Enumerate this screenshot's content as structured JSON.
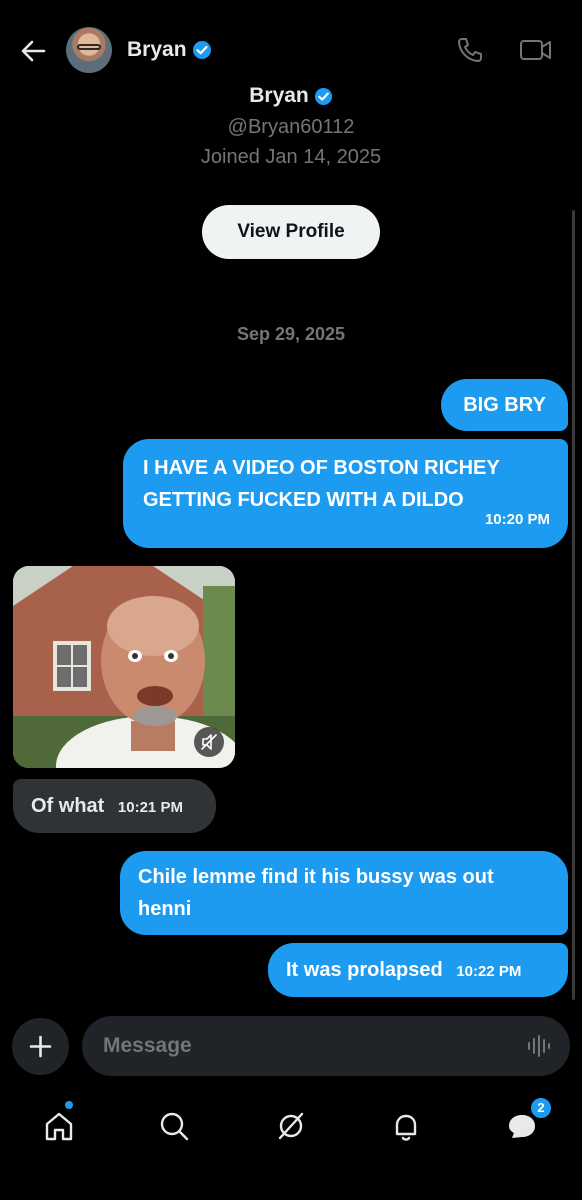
{
  "header": {
    "name": "Bryan",
    "verified": true
  },
  "profile": {
    "name": "Bryan",
    "handle": "@Bryan60112",
    "joined": "Joined Jan 14, 2025",
    "view_profile_label": "View Profile"
  },
  "conversation": {
    "date": "Sep 29, 2025",
    "messages": [
      {
        "direction": "out",
        "text": "BIG BRY"
      },
      {
        "direction": "out",
        "text": "I HAVE A VIDEO OF BOSTON RICHEY GETTING FUCKED WITH A DILDO",
        "time": "10:20 PM"
      },
      {
        "direction": "in",
        "type": "gif"
      },
      {
        "direction": "in",
        "text": "Of what",
        "time": "10:21 PM"
      },
      {
        "direction": "out",
        "text": "Chile lemme find it his bussy was out henni"
      },
      {
        "direction": "out",
        "text": "It was prolapsed",
        "time": "10:22 PM"
      }
    ]
  },
  "composer": {
    "placeholder": "Message"
  },
  "nav": {
    "messages_badge": "2"
  },
  "colors": {
    "accent": "#1d9bf0",
    "background": "#000000",
    "incoming_bubble": "#2f3336"
  },
  "icons": [
    "back-arrow-icon",
    "verified-badge-icon",
    "phone-icon",
    "video-camera-icon",
    "mute-icon",
    "plus-icon",
    "voice-icon",
    "home-icon",
    "search-icon",
    "grok-icon",
    "bell-icon",
    "messages-icon"
  ]
}
